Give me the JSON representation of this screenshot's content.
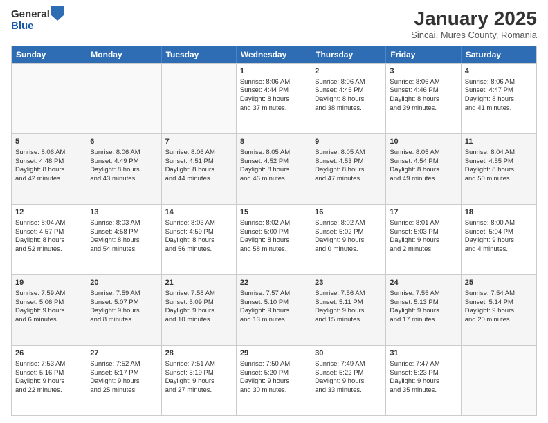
{
  "logo": {
    "general": "General",
    "blue": "Blue"
  },
  "title": "January 2025",
  "subtitle": "Sincai, Mures County, Romania",
  "headers": [
    "Sunday",
    "Monday",
    "Tuesday",
    "Wednesday",
    "Thursday",
    "Friday",
    "Saturday"
  ],
  "rows": [
    [
      {
        "day": "",
        "lines": []
      },
      {
        "day": "",
        "lines": []
      },
      {
        "day": "",
        "lines": []
      },
      {
        "day": "1",
        "lines": [
          "Sunrise: 8:06 AM",
          "Sunset: 4:44 PM",
          "Daylight: 8 hours",
          "and 37 minutes."
        ]
      },
      {
        "day": "2",
        "lines": [
          "Sunrise: 8:06 AM",
          "Sunset: 4:45 PM",
          "Daylight: 8 hours",
          "and 38 minutes."
        ]
      },
      {
        "day": "3",
        "lines": [
          "Sunrise: 8:06 AM",
          "Sunset: 4:46 PM",
          "Daylight: 8 hours",
          "and 39 minutes."
        ]
      },
      {
        "day": "4",
        "lines": [
          "Sunrise: 8:06 AM",
          "Sunset: 4:47 PM",
          "Daylight: 8 hours",
          "and 41 minutes."
        ]
      }
    ],
    [
      {
        "day": "5",
        "lines": [
          "Sunrise: 8:06 AM",
          "Sunset: 4:48 PM",
          "Daylight: 8 hours",
          "and 42 minutes."
        ]
      },
      {
        "day": "6",
        "lines": [
          "Sunrise: 8:06 AM",
          "Sunset: 4:49 PM",
          "Daylight: 8 hours",
          "and 43 minutes."
        ]
      },
      {
        "day": "7",
        "lines": [
          "Sunrise: 8:06 AM",
          "Sunset: 4:51 PM",
          "Daylight: 8 hours",
          "and 44 minutes."
        ]
      },
      {
        "day": "8",
        "lines": [
          "Sunrise: 8:05 AM",
          "Sunset: 4:52 PM",
          "Daylight: 8 hours",
          "and 46 minutes."
        ]
      },
      {
        "day": "9",
        "lines": [
          "Sunrise: 8:05 AM",
          "Sunset: 4:53 PM",
          "Daylight: 8 hours",
          "and 47 minutes."
        ]
      },
      {
        "day": "10",
        "lines": [
          "Sunrise: 8:05 AM",
          "Sunset: 4:54 PM",
          "Daylight: 8 hours",
          "and 49 minutes."
        ]
      },
      {
        "day": "11",
        "lines": [
          "Sunrise: 8:04 AM",
          "Sunset: 4:55 PM",
          "Daylight: 8 hours",
          "and 50 minutes."
        ]
      }
    ],
    [
      {
        "day": "12",
        "lines": [
          "Sunrise: 8:04 AM",
          "Sunset: 4:57 PM",
          "Daylight: 8 hours",
          "and 52 minutes."
        ]
      },
      {
        "day": "13",
        "lines": [
          "Sunrise: 8:03 AM",
          "Sunset: 4:58 PM",
          "Daylight: 8 hours",
          "and 54 minutes."
        ]
      },
      {
        "day": "14",
        "lines": [
          "Sunrise: 8:03 AM",
          "Sunset: 4:59 PM",
          "Daylight: 8 hours",
          "and 56 minutes."
        ]
      },
      {
        "day": "15",
        "lines": [
          "Sunrise: 8:02 AM",
          "Sunset: 5:00 PM",
          "Daylight: 8 hours",
          "and 58 minutes."
        ]
      },
      {
        "day": "16",
        "lines": [
          "Sunrise: 8:02 AM",
          "Sunset: 5:02 PM",
          "Daylight: 9 hours",
          "and 0 minutes."
        ]
      },
      {
        "day": "17",
        "lines": [
          "Sunrise: 8:01 AM",
          "Sunset: 5:03 PM",
          "Daylight: 9 hours",
          "and 2 minutes."
        ]
      },
      {
        "day": "18",
        "lines": [
          "Sunrise: 8:00 AM",
          "Sunset: 5:04 PM",
          "Daylight: 9 hours",
          "and 4 minutes."
        ]
      }
    ],
    [
      {
        "day": "19",
        "lines": [
          "Sunrise: 7:59 AM",
          "Sunset: 5:06 PM",
          "Daylight: 9 hours",
          "and 6 minutes."
        ]
      },
      {
        "day": "20",
        "lines": [
          "Sunrise: 7:59 AM",
          "Sunset: 5:07 PM",
          "Daylight: 9 hours",
          "and 8 minutes."
        ]
      },
      {
        "day": "21",
        "lines": [
          "Sunrise: 7:58 AM",
          "Sunset: 5:09 PM",
          "Daylight: 9 hours",
          "and 10 minutes."
        ]
      },
      {
        "day": "22",
        "lines": [
          "Sunrise: 7:57 AM",
          "Sunset: 5:10 PM",
          "Daylight: 9 hours",
          "and 13 minutes."
        ]
      },
      {
        "day": "23",
        "lines": [
          "Sunrise: 7:56 AM",
          "Sunset: 5:11 PM",
          "Daylight: 9 hours",
          "and 15 minutes."
        ]
      },
      {
        "day": "24",
        "lines": [
          "Sunrise: 7:55 AM",
          "Sunset: 5:13 PM",
          "Daylight: 9 hours",
          "and 17 minutes."
        ]
      },
      {
        "day": "25",
        "lines": [
          "Sunrise: 7:54 AM",
          "Sunset: 5:14 PM",
          "Daylight: 9 hours",
          "and 20 minutes."
        ]
      }
    ],
    [
      {
        "day": "26",
        "lines": [
          "Sunrise: 7:53 AM",
          "Sunset: 5:16 PM",
          "Daylight: 9 hours",
          "and 22 minutes."
        ]
      },
      {
        "day": "27",
        "lines": [
          "Sunrise: 7:52 AM",
          "Sunset: 5:17 PM",
          "Daylight: 9 hours",
          "and 25 minutes."
        ]
      },
      {
        "day": "28",
        "lines": [
          "Sunrise: 7:51 AM",
          "Sunset: 5:19 PM",
          "Daylight: 9 hours",
          "and 27 minutes."
        ]
      },
      {
        "day": "29",
        "lines": [
          "Sunrise: 7:50 AM",
          "Sunset: 5:20 PM",
          "Daylight: 9 hours",
          "and 30 minutes."
        ]
      },
      {
        "day": "30",
        "lines": [
          "Sunrise: 7:49 AM",
          "Sunset: 5:22 PM",
          "Daylight: 9 hours",
          "and 33 minutes."
        ]
      },
      {
        "day": "31",
        "lines": [
          "Sunrise: 7:47 AM",
          "Sunset: 5:23 PM",
          "Daylight: 9 hours",
          "and 35 minutes."
        ]
      },
      {
        "day": "",
        "lines": []
      }
    ]
  ]
}
